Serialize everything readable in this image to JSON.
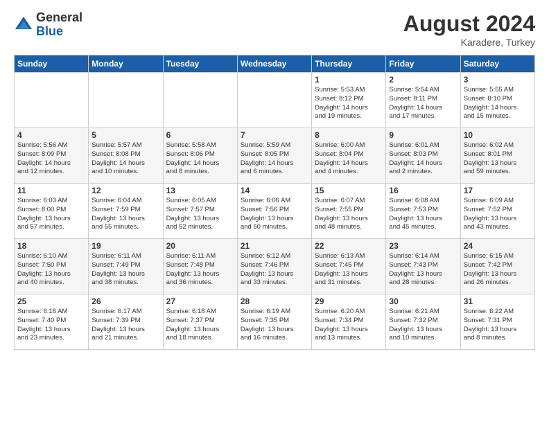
{
  "logo": {
    "general": "General",
    "blue": "Blue"
  },
  "header": {
    "month_year": "August 2024",
    "location": "Karadere, Turkey"
  },
  "weekdays": [
    "Sunday",
    "Monday",
    "Tuesday",
    "Wednesday",
    "Thursday",
    "Friday",
    "Saturday"
  ],
  "weeks": [
    [
      {
        "day": "",
        "info": ""
      },
      {
        "day": "",
        "info": ""
      },
      {
        "day": "",
        "info": ""
      },
      {
        "day": "",
        "info": ""
      },
      {
        "day": "1",
        "info": "Sunrise: 5:53 AM\nSunset: 8:12 PM\nDaylight: 14 hours\nand 19 minutes."
      },
      {
        "day": "2",
        "info": "Sunrise: 5:54 AM\nSunset: 8:11 PM\nDaylight: 14 hours\nand 17 minutes."
      },
      {
        "day": "3",
        "info": "Sunrise: 5:55 AM\nSunset: 8:10 PM\nDaylight: 14 hours\nand 15 minutes."
      }
    ],
    [
      {
        "day": "4",
        "info": "Sunrise: 5:56 AM\nSunset: 8:09 PM\nDaylight: 14 hours\nand 12 minutes."
      },
      {
        "day": "5",
        "info": "Sunrise: 5:57 AM\nSunset: 8:08 PM\nDaylight: 14 hours\nand 10 minutes."
      },
      {
        "day": "6",
        "info": "Sunrise: 5:58 AM\nSunset: 8:06 PM\nDaylight: 14 hours\nand 8 minutes."
      },
      {
        "day": "7",
        "info": "Sunrise: 5:59 AM\nSunset: 8:05 PM\nDaylight: 14 hours\nand 6 minutes."
      },
      {
        "day": "8",
        "info": "Sunrise: 6:00 AM\nSunset: 8:04 PM\nDaylight: 14 hours\nand 4 minutes."
      },
      {
        "day": "9",
        "info": "Sunrise: 6:01 AM\nSunset: 8:03 PM\nDaylight: 14 hours\nand 2 minutes."
      },
      {
        "day": "10",
        "info": "Sunrise: 6:02 AM\nSunset: 8:01 PM\nDaylight: 13 hours\nand 59 minutes."
      }
    ],
    [
      {
        "day": "11",
        "info": "Sunrise: 6:03 AM\nSunset: 8:00 PM\nDaylight: 13 hours\nand 57 minutes."
      },
      {
        "day": "12",
        "info": "Sunrise: 6:04 AM\nSunset: 7:59 PM\nDaylight: 13 hours\nand 55 minutes."
      },
      {
        "day": "13",
        "info": "Sunrise: 6:05 AM\nSunset: 7:57 PM\nDaylight: 13 hours\nand 52 minutes."
      },
      {
        "day": "14",
        "info": "Sunrise: 6:06 AM\nSunset: 7:56 PM\nDaylight: 13 hours\nand 50 minutes."
      },
      {
        "day": "15",
        "info": "Sunrise: 6:07 AM\nSunset: 7:55 PM\nDaylight: 13 hours\nand 48 minutes."
      },
      {
        "day": "16",
        "info": "Sunrise: 6:08 AM\nSunset: 7:53 PM\nDaylight: 13 hours\nand 45 minutes."
      },
      {
        "day": "17",
        "info": "Sunrise: 6:09 AM\nSunset: 7:52 PM\nDaylight: 13 hours\nand 43 minutes."
      }
    ],
    [
      {
        "day": "18",
        "info": "Sunrise: 6:10 AM\nSunset: 7:50 PM\nDaylight: 13 hours\nand 40 minutes."
      },
      {
        "day": "19",
        "info": "Sunrise: 6:11 AM\nSunset: 7:49 PM\nDaylight: 13 hours\nand 38 minutes."
      },
      {
        "day": "20",
        "info": "Sunrise: 6:11 AM\nSunset: 7:48 PM\nDaylight: 13 hours\nand 36 minutes."
      },
      {
        "day": "21",
        "info": "Sunrise: 6:12 AM\nSunset: 7:46 PM\nDaylight: 13 hours\nand 33 minutes."
      },
      {
        "day": "22",
        "info": "Sunrise: 6:13 AM\nSunset: 7:45 PM\nDaylight: 13 hours\nand 31 minutes."
      },
      {
        "day": "23",
        "info": "Sunrise: 6:14 AM\nSunset: 7:43 PM\nDaylight: 13 hours\nand 28 minutes."
      },
      {
        "day": "24",
        "info": "Sunrise: 6:15 AM\nSunset: 7:42 PM\nDaylight: 13 hours\nand 26 minutes."
      }
    ],
    [
      {
        "day": "25",
        "info": "Sunrise: 6:16 AM\nSunset: 7:40 PM\nDaylight: 13 hours\nand 23 minutes."
      },
      {
        "day": "26",
        "info": "Sunrise: 6:17 AM\nSunset: 7:39 PM\nDaylight: 13 hours\nand 21 minutes."
      },
      {
        "day": "27",
        "info": "Sunrise: 6:18 AM\nSunset: 7:37 PM\nDaylight: 13 hours\nand 18 minutes."
      },
      {
        "day": "28",
        "info": "Sunrise: 6:19 AM\nSunset: 7:35 PM\nDaylight: 13 hours\nand 16 minutes."
      },
      {
        "day": "29",
        "info": "Sunrise: 6:20 AM\nSunset: 7:34 PM\nDaylight: 13 hours\nand 13 minutes."
      },
      {
        "day": "30",
        "info": "Sunrise: 6:21 AM\nSunset: 7:32 PM\nDaylight: 13 hours\nand 10 minutes."
      },
      {
        "day": "31",
        "info": "Sunrise: 6:22 AM\nSunset: 7:31 PM\nDaylight: 13 hours\nand 8 minutes."
      }
    ]
  ]
}
